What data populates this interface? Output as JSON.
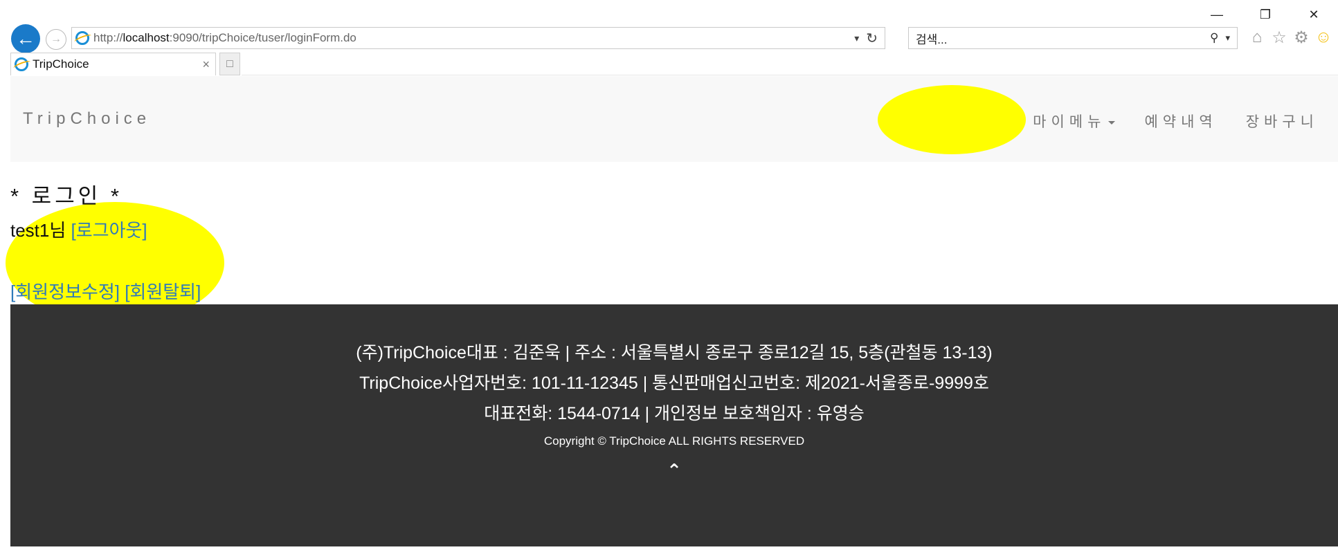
{
  "browser": {
    "window_controls": [
      "—",
      "❐",
      "✕"
    ],
    "back_icon": "back-arrow-icon",
    "forward_icon": "forward-arrow-icon",
    "address_scheme": "http://",
    "address_host": "localhost",
    "address_rest": ":9090/tripChoice/tuser/loginForm.do",
    "search_placeholder": "검색...",
    "tab_title": "TripChoice",
    "tab_close": "×",
    "accent_color": "#1a7ac9"
  },
  "navbar": {
    "brand": "TripChoice",
    "menu_my": "마이메뉴",
    "menu_reservations": "예약내역",
    "menu_cart": "장바구니"
  },
  "main": {
    "title": "* 로그인 *",
    "user_name": "test1님",
    "logout_link": "[로그아웃]",
    "edit_link": "[회원정보수정]",
    "withdraw_link": "[회원탈퇴]"
  },
  "footer": {
    "line1": "(주)TripChoice대표 : 김준욱 | 주소 : 서울특별시 종로구 종로12길 15, 5층(관철동 13-13)",
    "line2": "TripChoice사업자번호: 101-11-12345 | 통신판매업신고번호: 제2021-서울종로-9999호",
    "line3": "대표전화: 1544-0714 | 개인정보 보호책임자 : 유영승",
    "copyright": "Copyright © TripChoice ALL RIGHTS RESERVED",
    "up_icon": "chevron-up-icon"
  },
  "annotation": {
    "highlight_color": "#ffff00"
  }
}
